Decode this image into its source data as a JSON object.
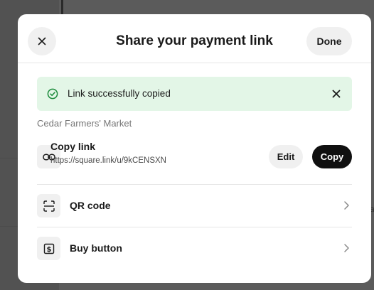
{
  "modal": {
    "title": "Share your payment link",
    "done_label": "Done"
  },
  "banner": {
    "message": "Link successfully copied"
  },
  "market_name": "Cedar Farmers' Market",
  "copy_link": {
    "title": "Copy link",
    "url": "https://square.link/u/9kCENSXN",
    "edit_label": "Edit",
    "copy_label": "Copy"
  },
  "options": [
    {
      "label": "QR code",
      "icon": "qr-code-icon"
    },
    {
      "label": "Buy button",
      "icon": "dollar-button-icon"
    }
  ],
  "colors": {
    "banner_bg": "#e3f6e7",
    "check_green": "#1a8a3a",
    "primary_button": "#101010",
    "overlay": "#5b5b5b"
  }
}
